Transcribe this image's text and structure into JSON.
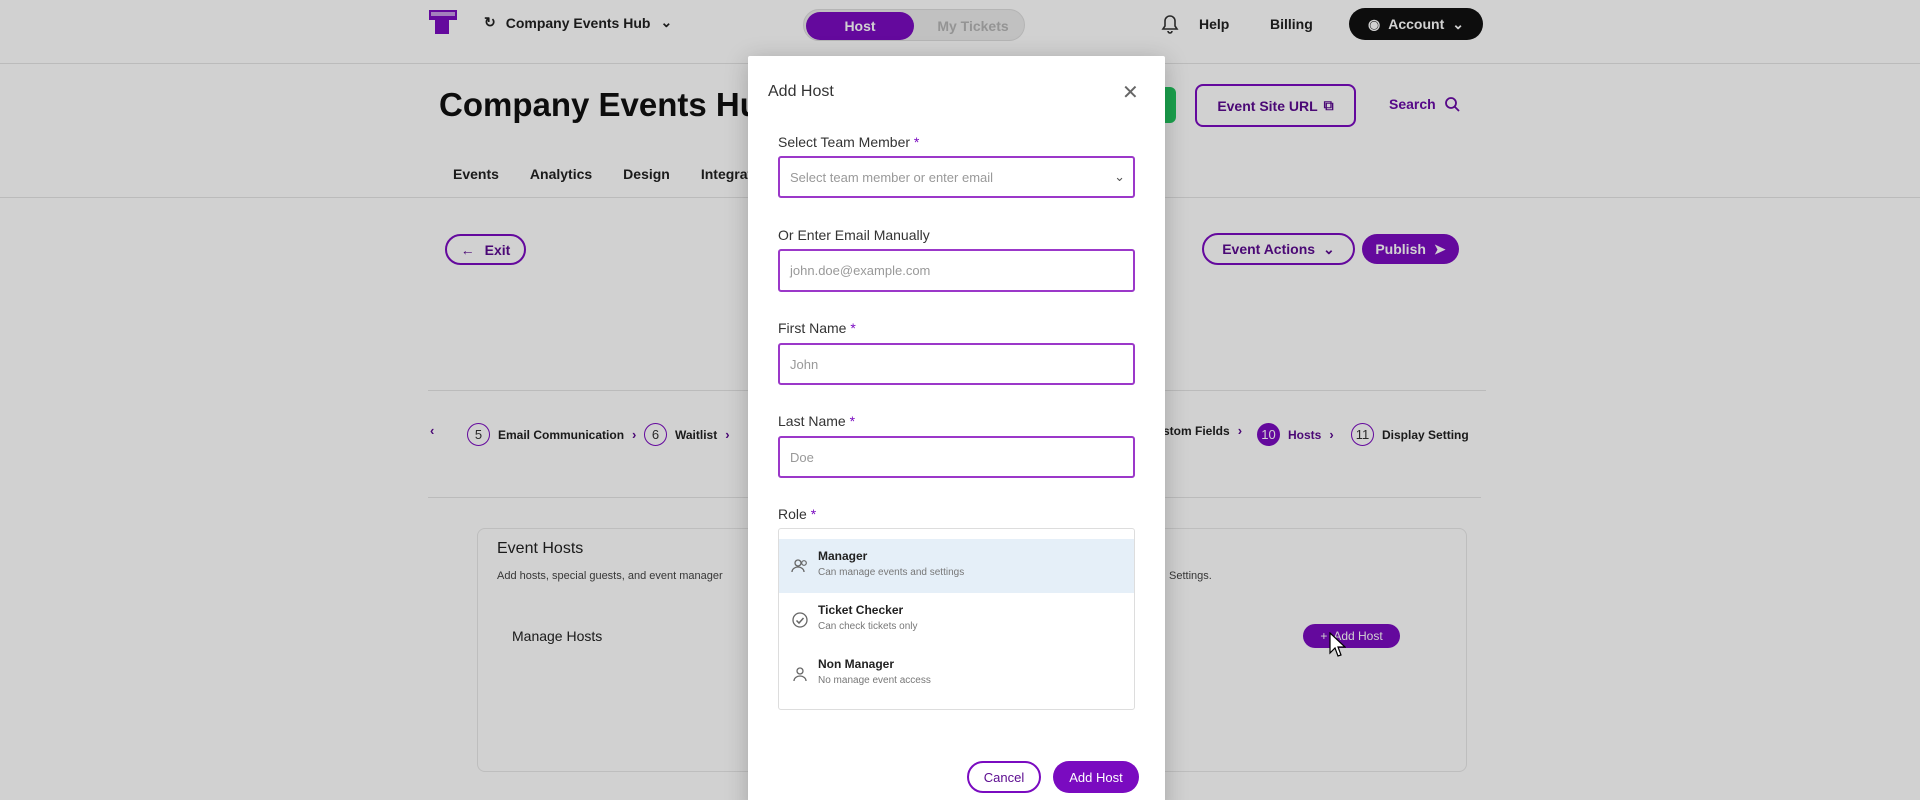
{
  "topbar": {
    "app_title": "Company Events Hub",
    "mode_toggle": {
      "active": "Host",
      "inactive": "My Tickets"
    },
    "help": "Help",
    "billing": "Billing",
    "account": "Account"
  },
  "page": {
    "title": "Company Events Hub",
    "event_site_url": "Event Site URL",
    "search": "Search",
    "tabs": [
      "Events",
      "Analytics",
      "Design",
      "Integrations"
    ],
    "exit": "Exit",
    "event_actions": "Event Actions",
    "publish": "Publish"
  },
  "steps": [
    {
      "num": "5",
      "label": "Email Communication",
      "active": false
    },
    {
      "num": "6",
      "label": "Waitlist",
      "active": false
    },
    {
      "num": "",
      "label": "stom Fields",
      "active": false
    },
    {
      "num": "10",
      "label": "Hosts",
      "active": true
    },
    {
      "num": "11",
      "label": "Display Setting",
      "active": false
    }
  ],
  "hosts_section": {
    "title": "Event Hosts",
    "subtitle": "Add hosts, special guests, and event manager",
    "subtitle_right": "Settings.",
    "manage_hosts": "Manage Hosts",
    "add_host_button": "Add Host"
  },
  "modal": {
    "title": "Add Host",
    "team_member": {
      "label": "Select Team Member",
      "required": "*",
      "placeholder": "Select team member or enter email"
    },
    "email": {
      "label": "Or Enter Email Manually",
      "placeholder": "john.doe@example.com"
    },
    "first_name": {
      "label": "First Name",
      "required": "*",
      "placeholder": "John"
    },
    "last_name": {
      "label": "Last Name",
      "required": "*",
      "placeholder": "Doe"
    },
    "role": {
      "label": "Role",
      "required": "*",
      "options": [
        {
          "name": "Manager",
          "desc": "Can manage events and settings",
          "icon": "users-icon",
          "selected": true
        },
        {
          "name": "Ticket Checker",
          "desc": "Can check tickets only",
          "icon": "check-circle-icon",
          "selected": false
        },
        {
          "name": "Non Manager",
          "desc": "No manage event access",
          "icon": "user-icon",
          "selected": false
        }
      ]
    },
    "cancel": "Cancel",
    "submit": "Add Host"
  },
  "colors": {
    "accent": "#7a0bc0",
    "accent_dark": "#5b0a8f",
    "green": "#22c55e",
    "selected_row": "#e5eff8"
  }
}
